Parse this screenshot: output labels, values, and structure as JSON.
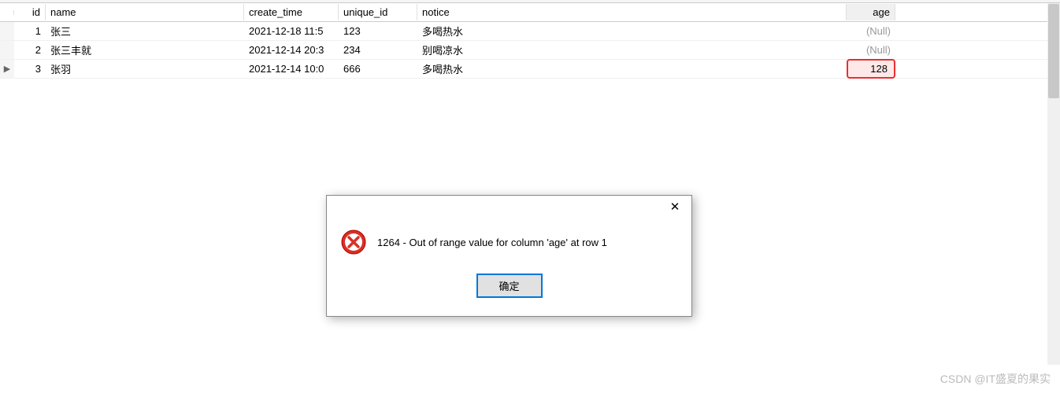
{
  "table": {
    "headers": {
      "id": "id",
      "name": "name",
      "create_time": "create_time",
      "unique_id": "unique_id",
      "notice": "notice",
      "age": "age"
    },
    "rows": [
      {
        "marker": "",
        "id": "1",
        "name": "张三",
        "create_time": "2021-12-18 11:5",
        "unique_id": "123",
        "notice": "多喝热水",
        "age": "(Null)",
        "age_null": true,
        "highlight": false
      },
      {
        "marker": "",
        "id": "2",
        "name": "张三丰就",
        "create_time": "2021-12-14 20:3",
        "unique_id": "234",
        "notice": "别喝凉水",
        "age": "(Null)",
        "age_null": true,
        "highlight": false
      },
      {
        "marker": "▶",
        "id": "3",
        "name": "张羽",
        "create_time": "2021-12-14 10:0",
        "unique_id": "666",
        "notice": "多喝热水",
        "age": "128",
        "age_null": false,
        "highlight": true
      }
    ]
  },
  "dialog": {
    "close_label": "✕",
    "message": "1264 - Out of range value for column 'age' at row 1",
    "ok_label": "确定"
  },
  "watermark": "CSDN @IT盛夏的果实"
}
